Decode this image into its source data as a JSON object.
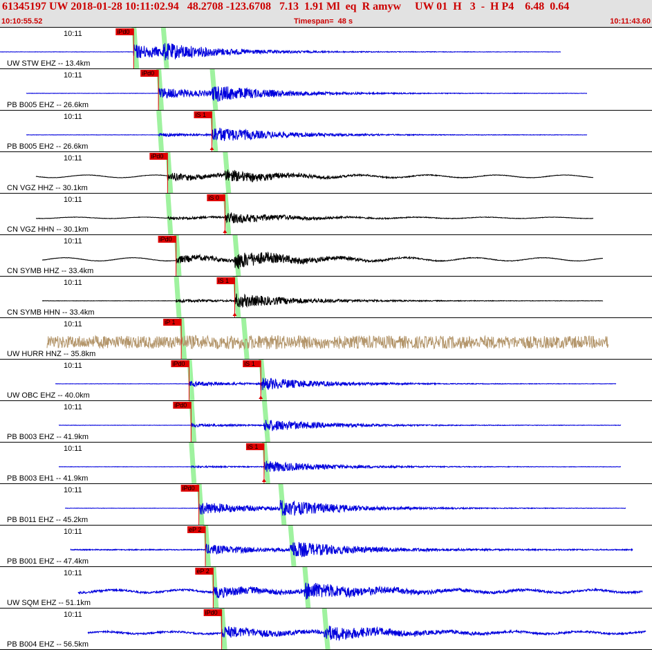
{
  "header": {
    "main": "61345197 UW 2018-01-28 10:11:02.94   48.2708 -123.6708   7.13  1.91 Ml  eq  R amyw     UW 01  H   3  -  H P4    6.48  0.64",
    "start_time": "10:10:55.52",
    "timespan": "Timespan=  48 s",
    "end_time": "10:11:43.60"
  },
  "tick_label": "10:11",
  "colors": {
    "pick": "#e00000",
    "predicted": "#9ff29f",
    "blue": "#0000dd",
    "black": "#000000",
    "brown": "#b3956a"
  },
  "traces": [
    {
      "label": "UW STW EHZ -- 13.4km",
      "color": "blue",
      "start": 0,
      "end": 0.86,
      "noise": 0.01,
      "p": 0.205,
      "s": 0.25,
      "pamp": 0.45,
      "samp": 0.3,
      "pick": "iPd0",
      "pick_at": "p"
    },
    {
      "label": "PB B005 EHZ -- 26.6km",
      "color": "blue",
      "start": 0.04,
      "end": 0.9,
      "noise": 0.01,
      "p": 0.243,
      "s": 0.325,
      "pamp": 0.35,
      "samp": 0.4,
      "pick": "iPd0",
      "pick_at": "p"
    },
    {
      "label": "PB B005 EH2 -- 26.6km",
      "color": "blue",
      "start": 0.04,
      "end": 0.9,
      "noise": 0.01,
      "p": 0.243,
      "s": 0.325,
      "pamp": 0.1,
      "samp": 0.45,
      "pick": "iS 1",
      "pick_at": "s"
    },
    {
      "label": "CN VGZ HHZ -- 30.1km",
      "color": "black",
      "start": 0.055,
      "end": 0.91,
      "noise": 0.01,
      "wave": 0.1,
      "p": 0.257,
      "s": 0.345,
      "pamp": 0.25,
      "samp": 0.3,
      "pick": "iPd0",
      "pick_at": "p"
    },
    {
      "label": "CN VGZ HHN -- 30.1km",
      "color": "black",
      "start": 0.055,
      "end": 0.91,
      "noise": 0.01,
      "wave": 0.05,
      "p": 0.257,
      "s": 0.345,
      "pamp": 0.1,
      "samp": 0.3,
      "pick": "iS 0",
      "pick_at": "s"
    },
    {
      "label": "CN SYMB HHZ -- 33.4km",
      "color": "black",
      "start": 0.065,
      "end": 0.925,
      "noise": 0.01,
      "wave": 0.12,
      "p": 0.27,
      "s": 0.36,
      "pamp": 0.25,
      "samp": 0.45,
      "pick": "iPd0",
      "pick_at": "p"
    },
    {
      "label": "CN SYMB HHN -- 33.4km",
      "color": "black",
      "start": 0.065,
      "end": 0.925,
      "noise": 0.01,
      "p": 0.27,
      "s": 0.36,
      "pamp": 0.1,
      "samp": 0.4,
      "pick": "iS 1",
      "pick_at": "s"
    },
    {
      "label": "UW HURR HNZ -- 35.8km",
      "color": "brown",
      "start": 0.072,
      "end": 0.933,
      "noise": 0.38,
      "p": 0.278,
      "s": 0.373,
      "pamp": 0.05,
      "samp": 0.05,
      "pick": "iP 1",
      "pick_at": "p"
    },
    {
      "label": "UW OBC EHZ -- 40.0km",
      "color": "blue",
      "start": 0.085,
      "end": 0.945,
      "noise": 0.01,
      "p": 0.29,
      "s": 0.4,
      "pamp": 0.15,
      "samp": 0.35,
      "pick": "iPd0",
      "pick_at": "p",
      "pick2": "iS 1",
      "pick2_at": "s"
    },
    {
      "label": "PB B003 EHZ -- 41.9km",
      "color": "blue",
      "start": 0.09,
      "end": 0.952,
      "noise": 0.01,
      "p": 0.293,
      "s": 0.405,
      "pamp": 0.1,
      "samp": 0.35,
      "pick": "iPd0",
      "pick_at": "p"
    },
    {
      "label": "PB B003 EH1 -- 41.9km",
      "color": "blue",
      "start": 0.09,
      "end": 0.952,
      "noise": 0.01,
      "p": 0.293,
      "s": 0.405,
      "pamp": 0.05,
      "samp": 0.35,
      "pick": "iS 1",
      "pick_at": "s"
    },
    {
      "label": "PB B011 EHZ -- 45.2km",
      "color": "blue",
      "start": 0.1,
      "end": 0.96,
      "noise": 0.01,
      "p": 0.305,
      "s": 0.43,
      "pamp": 0.4,
      "samp": 0.45,
      "pick": "iPd0",
      "pick_at": "p"
    },
    {
      "label": "PB B001 EHZ -- 47.4km",
      "color": "blue",
      "start": 0.108,
      "end": 0.97,
      "noise": 0.03,
      "p": 0.315,
      "s": 0.445,
      "pamp": 0.3,
      "samp": 0.45,
      "pick": "eP 2",
      "pick_at": "p"
    },
    {
      "label": "UW SQM EHZ -- 51.1km",
      "color": "blue",
      "start": 0.12,
      "end": 0.985,
      "noise": 0.06,
      "wave": 0.1,
      "p": 0.327,
      "s": 0.467,
      "pamp": 0.3,
      "samp": 0.45,
      "pick": "eP 2",
      "pick_at": "p"
    },
    {
      "label": "PB B004 EHZ -- 56.5km",
      "color": "blue",
      "start": 0.135,
      "end": 0.99,
      "noise": 0.05,
      "wave": 0.08,
      "p": 0.34,
      "s": 0.497,
      "pamp": 0.35,
      "samp": 0.4,
      "pick": "iPd0",
      "pick_at": "p"
    }
  ]
}
